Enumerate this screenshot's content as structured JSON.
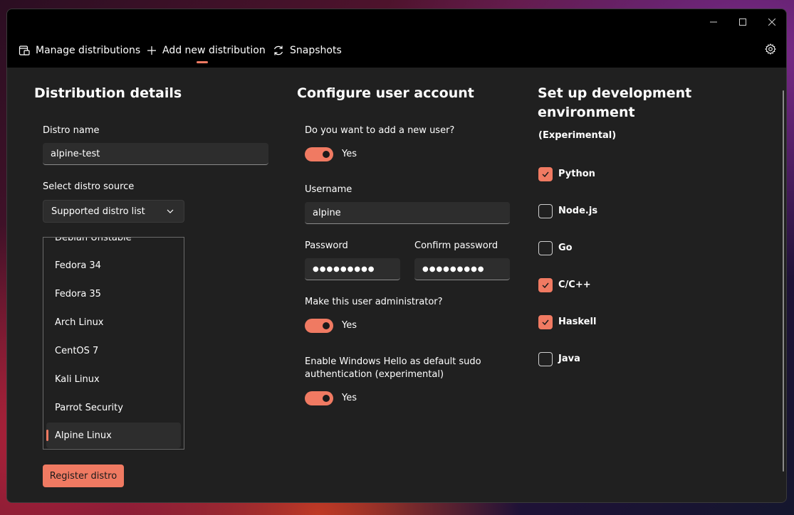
{
  "nav": {
    "manage": "Manage distributions",
    "add": "Add new distribution",
    "snapshots": "Snapshots"
  },
  "distribution": {
    "heading": "Distribution details",
    "name_label": "Distro name",
    "name_value": "alpine-test",
    "source_label": "Select distro source",
    "source_value": "Supported distro list",
    "list_items": [
      "Debian Unstable",
      "Fedora 34",
      "Fedora 35",
      "Arch Linux",
      "CentOS 7",
      "Kali Linux",
      "Parrot Security",
      "Alpine Linux"
    ],
    "register_label": "Register distro"
  },
  "user": {
    "heading": "Configure user account",
    "add_user_question": "Do you want to add a new user?",
    "add_user_toggle": "Yes",
    "username_label": "Username",
    "username_value": "alpine",
    "password_label": "Password",
    "password_value": "●●●●●●●●●",
    "confirm_label": "Confirm password",
    "confirm_value": "●●●●●●●●●",
    "admin_question": "Make this user administrator?",
    "admin_toggle": "Yes",
    "hello_question_line1": "Enable Windows Hello as default sudo",
    "hello_question_line2": "authentication (experimental)",
    "hello_toggle": "Yes"
  },
  "dev": {
    "heading_line1": "Set up development",
    "heading_line2": "environment",
    "subheading": "(Experimental)",
    "options": [
      {
        "label": "Python",
        "checked": true
      },
      {
        "label": "Node.js",
        "checked": false
      },
      {
        "label": "Go",
        "checked": false
      },
      {
        "label": "C/C++",
        "checked": true
      },
      {
        "label": "Haskell",
        "checked": true
      },
      {
        "label": "Java",
        "checked": false
      }
    ]
  },
  "colors": {
    "accent": "#f07a62",
    "surface": "#202020",
    "titlebar": "#000000"
  }
}
